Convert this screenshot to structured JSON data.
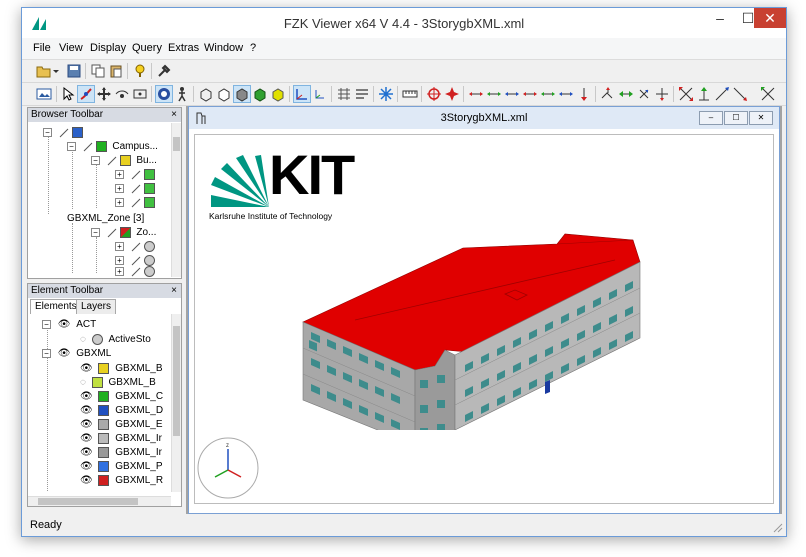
{
  "app": {
    "title": "FZK Viewer x64 V 4.4 - 3StorygbXML.xml",
    "accent": "#c84031"
  },
  "window_controls": {
    "minimize": "–",
    "maximize": "☐",
    "close": "✕"
  },
  "menu": [
    "File",
    "View",
    "Display",
    "Query",
    "Extras",
    "Window",
    "?"
  ],
  "toolbar1": [
    "open-icon",
    "dropdown-icon",
    "save-icon",
    "copy-icon",
    "paste-icon",
    "info-icon",
    "tools-icon"
  ],
  "toolbar2": [
    "screenshot-icon",
    "select-icon",
    "orbit-icon",
    "pan-icon",
    "walk-icon",
    "zoom-fit-icon",
    "render-icon",
    "wireframe-icon",
    "solid-icon",
    "shaded-icon",
    "transparent-icon",
    "axis-icon",
    "axis-small-icon",
    "grid-icon",
    "list-icon",
    "light-icon",
    "ruler-icon",
    "target-icon",
    "explode-icon"
  ],
  "browser": {
    "header": "Browser Toolbar",
    "close": "×",
    "rows": [
      {
        "label": "",
        "indent": 0
      },
      {
        "label": "Campus...",
        "indent": 1
      },
      {
        "label": "Bu...",
        "indent": 2
      },
      {
        "label": "",
        "indent": 3
      },
      {
        "label": "",
        "indent": 3
      },
      {
        "label": "",
        "indent": 3
      },
      {
        "label": "GBXML_Zone [3]",
        "indent": 1
      },
      {
        "label": "Zo...",
        "indent": 2
      },
      {
        "label": "",
        "indent": 3
      },
      {
        "label": "",
        "indent": 3
      },
      {
        "label": "",
        "indent": 3
      }
    ]
  },
  "element": {
    "header": "Element Toolbar",
    "close": "×",
    "tabs": [
      "Elements",
      "Layers"
    ],
    "rows": [
      {
        "label": "ACT",
        "indent": 0
      },
      {
        "label": "ActiveSto",
        "indent": 1
      },
      {
        "label": "GBXML",
        "indent": 0
      },
      {
        "label": "GBXML_B",
        "indent": 1
      },
      {
        "label": "GBXML_B",
        "indent": 1
      },
      {
        "label": "GBXML_C",
        "indent": 1
      },
      {
        "label": "GBXML_D",
        "indent": 1
      },
      {
        "label": "GBXML_E",
        "indent": 1
      },
      {
        "label": "GBXML_Ir",
        "indent": 1
      },
      {
        "label": "GBXML_Ir",
        "indent": 1
      },
      {
        "label": "GBXML_P",
        "indent": 1
      },
      {
        "label": "GBXML_R",
        "indent": 1
      }
    ]
  },
  "document": {
    "title": "3StorygbXML.xml",
    "controls": [
      "–",
      "☐",
      "✕"
    ]
  },
  "logo": {
    "text": "KIT",
    "tagline": "Karlsruhe Institute of Technology",
    "color": "#009682"
  },
  "model": {
    "roof_color": "#e00000",
    "wall_color": "#a8a8a8",
    "window_color": "#3e8c8c"
  },
  "status": {
    "text": "Ready"
  }
}
